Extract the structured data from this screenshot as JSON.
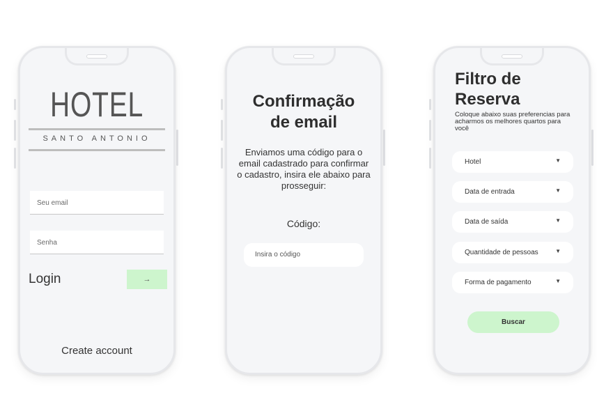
{
  "login_screen": {
    "brand_title": "HOTEL",
    "brand_subtitle": "SANTO ANTONIO",
    "email_placeholder": "Seu email",
    "password_placeholder": "Senha",
    "login_label": "Login",
    "submit_icon": "→",
    "create_account": "Create account"
  },
  "confirm_screen": {
    "title_line1": "Confirmação",
    "title_line2": "de email",
    "message": "Enviamos uma código para o email cadastrado para confirmar o cadastro, insira ele abaixo para prosseguir:",
    "code_label": "Código:",
    "code_placeholder": "Insira o código"
  },
  "filter_screen": {
    "title_line1": "Filtro de",
    "title_line2": "Reserva",
    "subtitle": "Coloque abaixo suas preferencias para acharmos os melhores quartos para você",
    "selects": [
      {
        "label": "Hotel"
      },
      {
        "label": "Data de entrada"
      },
      {
        "label": "Data de saída"
      },
      {
        "label": "Quantidade de pessoas"
      },
      {
        "label": "Forma de pagamento"
      }
    ],
    "caret": "▼",
    "search_button": "Buscar"
  },
  "colors": {
    "accent_green": "#cdf5cd",
    "screen_bg": "#f5f6f8"
  }
}
